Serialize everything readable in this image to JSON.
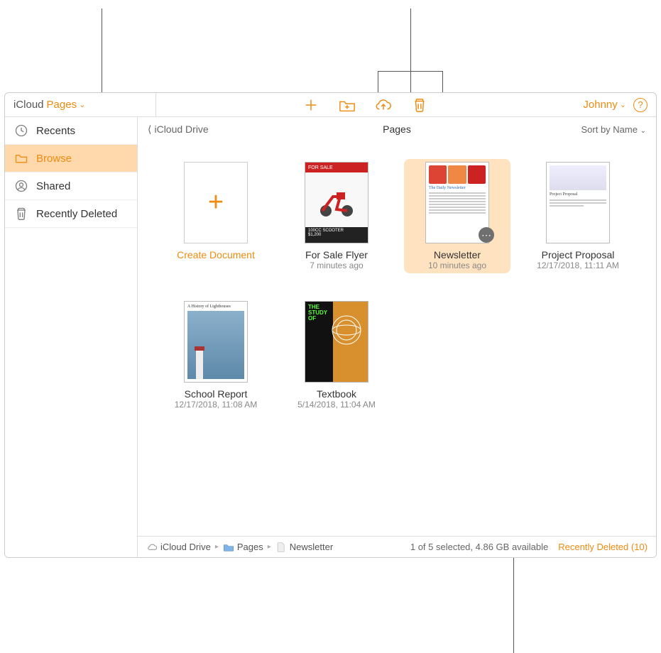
{
  "header": {
    "icloud_label": "iCloud",
    "app_label": "Pages",
    "user_name": "Johnny",
    "help_symbol": "?"
  },
  "sidebar": {
    "items": [
      {
        "label": "Recents",
        "icon": "clock"
      },
      {
        "label": "Browse",
        "icon": "folder",
        "selected": true
      },
      {
        "label": "Shared",
        "icon": "person"
      },
      {
        "label": "Recently Deleted",
        "icon": "trash"
      }
    ]
  },
  "main": {
    "back_label": "iCloud Drive",
    "folder_title": "Pages",
    "sort_label": "Sort by Name"
  },
  "documents": {
    "create_label": "Create Document",
    "items": [
      {
        "title": "For Sale Flyer",
        "subtitle": "7 minutes ago"
      },
      {
        "title": "Newsletter",
        "subtitle": "10 minutes ago",
        "selected": true
      },
      {
        "title": "Project Proposal",
        "subtitle": "12/17/2018, 11:11 AM"
      },
      {
        "title": "School Report",
        "subtitle": "12/17/2018, 11:08 AM"
      },
      {
        "title": "Textbook",
        "subtitle": "5/14/2018, 11:04 AM"
      }
    ]
  },
  "footer": {
    "crumbs": [
      "iCloud Drive",
      "Pages",
      "Newsletter"
    ],
    "status": "1 of 5 selected, 4.86 GB available",
    "recently_deleted": "Recently Deleted (10)"
  },
  "thumb_text": {
    "for_sale": "FOR SALE",
    "price1": "100CC SCOOTER",
    "price2": "$1,200",
    "newsletter_title": "The Daily Newsletter",
    "school_title": "A History of Lighthouses",
    "project_title": "Project Proposal",
    "textbook": "THE STUDY OF"
  }
}
